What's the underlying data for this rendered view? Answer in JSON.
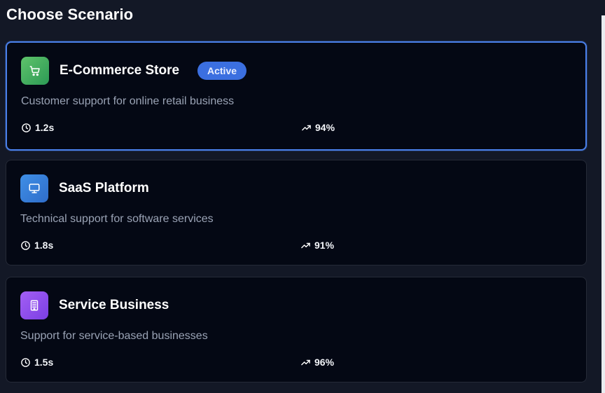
{
  "page": {
    "title": "Choose Scenario"
  },
  "scenarios": [
    {
      "name": "E-Commerce Store",
      "badge": "Active",
      "description": "Customer support for online retail business",
      "response_time": "1.2s",
      "success_rate": "94%",
      "icon": "shopping-cart-icon",
      "icon_colors": [
        "#5fc36b",
        "#2c9a55"
      ]
    },
    {
      "name": "SaaS Platform",
      "description": "Technical support for software services",
      "response_time": "1.8s",
      "success_rate": "91%",
      "icon": "monitor-icon",
      "icon_colors": [
        "#3f8fe6",
        "#2f6dca"
      ]
    },
    {
      "name": "Service Business",
      "description": "Support for service-based businesses",
      "response_time": "1.5s",
      "success_rate": "96%",
      "icon": "building-icon",
      "icon_colors": [
        "#a35ff4",
        "#7b3fe4"
      ]
    }
  ],
  "colors": {
    "background": "#131826",
    "card": "#040814",
    "active_border": "#4a80ea",
    "badge": "#3b6fe0"
  }
}
